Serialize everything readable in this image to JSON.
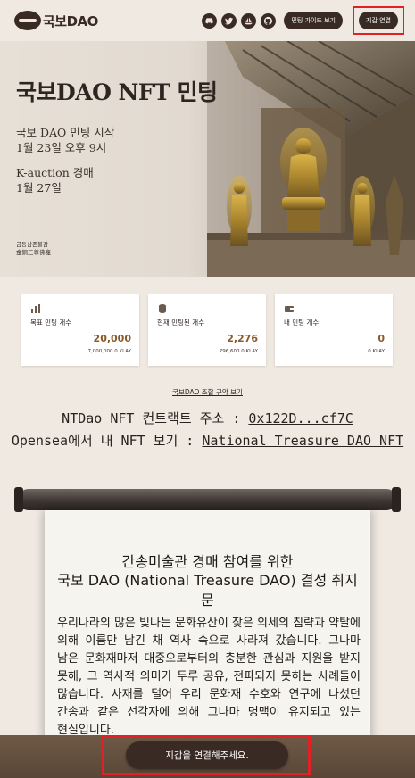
{
  "header": {
    "logo_text": "국보DAO",
    "social_icons": [
      "discord-icon",
      "twitter-icon",
      "opensea-icon",
      "github-icon"
    ],
    "guide_label": "민팅 가이드 보기",
    "connect_label": "지갑 연결"
  },
  "hero": {
    "title": "국보DAO NFT 민팅",
    "mint_start_label": "국보 DAO 민팅 시작",
    "mint_start_date": "1월 23일 오후 9시",
    "auction_label": "K-auction 경매",
    "auction_date": "1월 27일",
    "caption_1": "금동삼존불감",
    "caption_2": "金銅三尊佛龕"
  },
  "stats": [
    {
      "label": "목표 민팅 개수",
      "value": "20,000",
      "sub": "7,000,000.0 KLAY",
      "icon": "chart-icon"
    },
    {
      "label": "현재 민팅된 개수",
      "value": "2,276",
      "sub": "796,600.0 KLAY",
      "icon": "coins-icon"
    },
    {
      "label": "내 민팅 개수",
      "value": "0",
      "sub": "0 KLAY",
      "icon": "wallet-icon"
    }
  ],
  "rules_link": "국보DAO 조합 규약 보기",
  "contract": {
    "label": "NTDao NFT 컨트랙트 주소 : ",
    "address": "0x122D...cf7C"
  },
  "opensea": {
    "label": "Opensea에서 내 NFT 보기 : ",
    "link": "National Treasure DAO NFT"
  },
  "scroll": {
    "title": "간송미술관 경매 참여를 위한",
    "subtitle": "국보 DAO (National Treasure DAO) 결성 취지문",
    "body": "우리나라의 많은 빛나는 문화유산이 잦은 외세의 침략과 약탈에 의해 이름만 남긴 채 역사 속으로 사라져 갔습니다. 그나마 남은 문화재마저 대중으로부터의 충분한 관심과 지원을 받지 못해, 그 역사적 의미가 두루 공유, 전파되지 못하는 사례들이 많습니다. 사재를 털어 우리 문화재 수호와 연구에 나섰던 간송과 같은 선각자에 의해 그나마 명맥이 유지되고 있는 현실입니다."
  },
  "bottom_button": "지갑을 연결해주세요.",
  "colors": {
    "background": "#efe9e1",
    "brand_dark": "#3a2a24",
    "value_accent": "#8a5a2b",
    "highlight_red": "#e32028",
    "bottom_bar": "#5a4636"
  }
}
